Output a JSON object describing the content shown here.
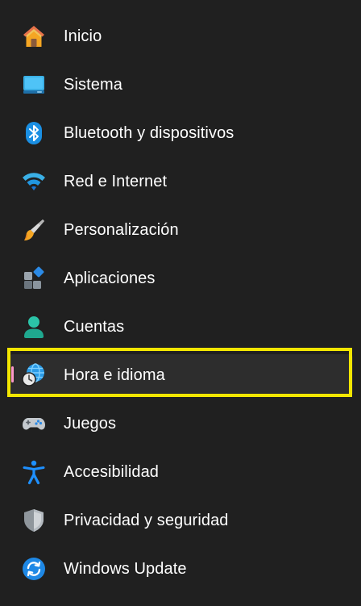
{
  "sidebar": {
    "items": [
      {
        "label": "Inicio",
        "icon": "home-icon"
      },
      {
        "label": "Sistema",
        "icon": "system-monitor-icon"
      },
      {
        "label": "Bluetooth y dispositivos",
        "icon": "bluetooth-icon"
      },
      {
        "label": "Red e Internet",
        "icon": "wifi-icon"
      },
      {
        "label": "Personalización",
        "icon": "paintbrush-icon"
      },
      {
        "label": "Aplicaciones",
        "icon": "apps-icon"
      },
      {
        "label": "Cuentas",
        "icon": "account-icon"
      },
      {
        "label": "Hora e idioma",
        "icon": "time-language-icon",
        "selected": true
      },
      {
        "label": "Juegos",
        "icon": "gamepad-icon"
      },
      {
        "label": "Accesibilidad",
        "icon": "accessibility-icon"
      },
      {
        "label": "Privacidad y seguridad",
        "icon": "shield-icon"
      },
      {
        "label": "Windows Update",
        "icon": "windows-update-icon"
      }
    ]
  },
  "colors": {
    "background": "#202020",
    "selected_background": "#2d2d2d",
    "selected_indicator": "#ff99c8",
    "highlight_border": "#f2e600",
    "text": "#ffffff"
  }
}
